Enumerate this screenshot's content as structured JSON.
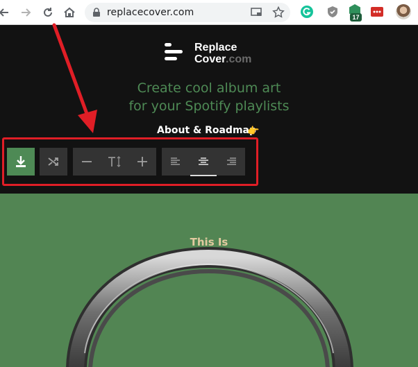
{
  "browser": {
    "url": "replacecover.com",
    "extension_badge": "17",
    "icons": [
      "back-arrow-icon",
      "forward-arrow-icon",
      "reload-icon",
      "home-icon",
      "lock-icon",
      "cast-icon",
      "star-icon",
      "grammarly-icon",
      "shield-extension-icon",
      "cube-extension-icon",
      "lastpass-icon",
      "profile-avatar"
    ]
  },
  "site": {
    "brand_line1": "Replace",
    "brand_line2": "Cover",
    "brand_suffix": ".com",
    "tagline_line1": "Create cool album art",
    "tagline_line2": "for your Spotify playlists",
    "about_link": "About & Roadmap",
    "about_emoji": "👉"
  },
  "toolbar": {
    "buttons": [
      "download-icon",
      "shuffle-icon",
      "minus-icon",
      "text-size-icon",
      "plus-icon",
      "align-left-icon",
      "align-center-icon",
      "align-right-icon"
    ],
    "active_alignment": "center",
    "highlight_color": "#e01e26"
  },
  "canvas": {
    "heading": "This Is",
    "background_color": "#528553",
    "heading_color": "#e2caa0"
  },
  "colors": {
    "accent_green": "#4e8a55",
    "header_bg": "#121212",
    "button_bg": "#333333",
    "annotation_red": "#e01e26"
  }
}
